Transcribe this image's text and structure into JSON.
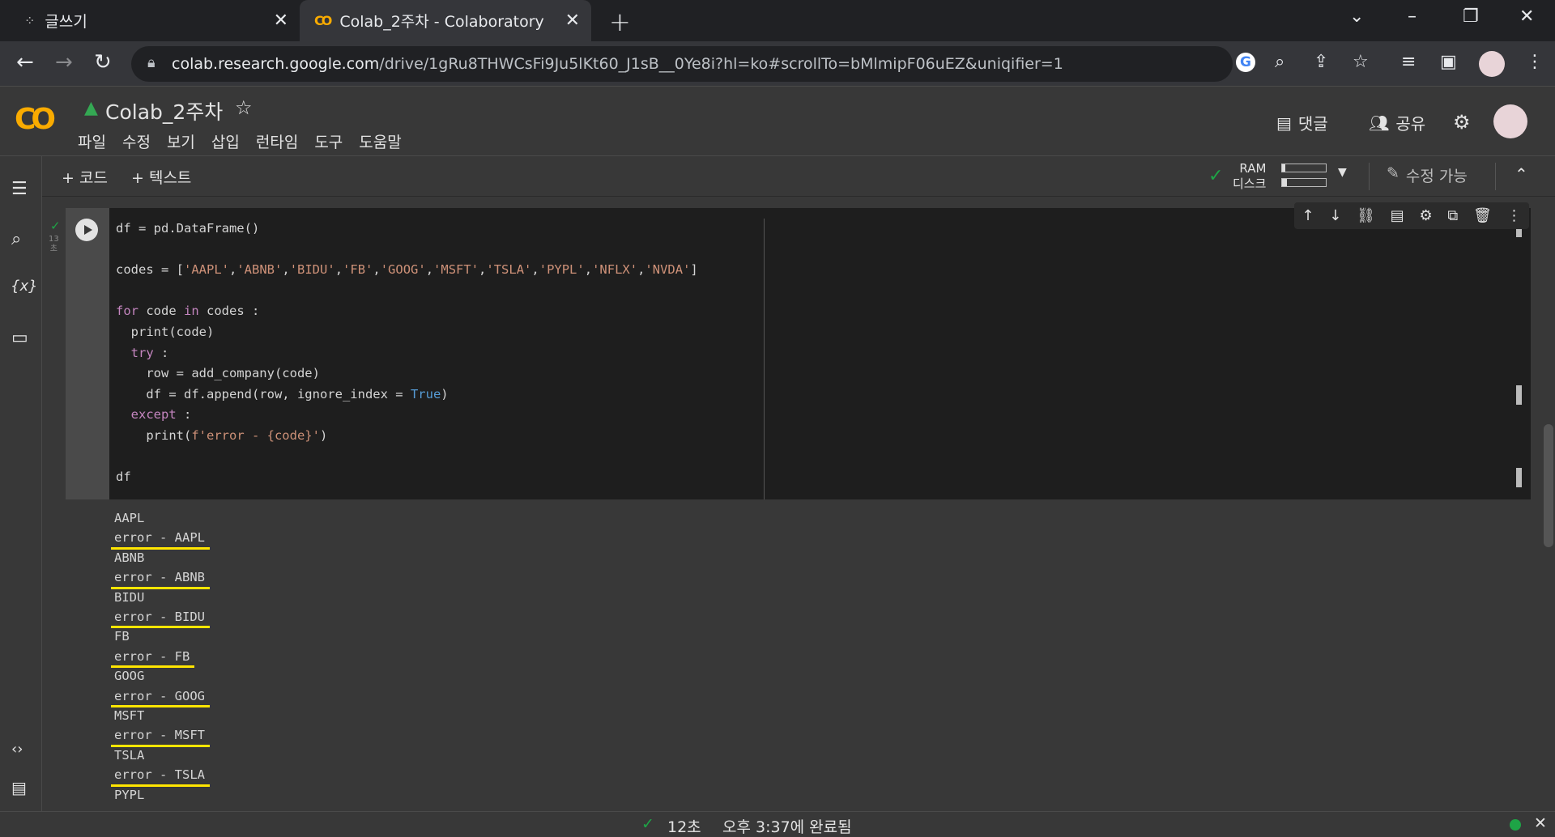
{
  "browser": {
    "tabs": [
      {
        "title": "글쓰기",
        "close": "✕"
      },
      {
        "title": "Colab_2주차 - Colaboratory",
        "close": "✕"
      }
    ],
    "new_tab": "+",
    "url_host": "colab.research.google.com",
    "url_path": "/drive/1gRu8THWCsFi9Ju5lKt60_J1sB__0Ye8i?hl=ko#scrollTo=bMlmipF06uEZ&uniqifier=1"
  },
  "colab": {
    "notebook_title": "Colab_2주차",
    "menu": [
      "파일",
      "수정",
      "보기",
      "삽입",
      "런타임",
      "도구",
      "도움말"
    ],
    "comment_label": "댓글",
    "share_label": "공유",
    "add_code_label": "+ 코드",
    "add_text_label": "+ 텍스트",
    "ram_label": "RAM",
    "disk_label": "디스크",
    "edit_mode_label": "수정 가능",
    "exec_count": "13",
    "exec_unit": "초"
  },
  "cell": {
    "lines": [
      "df = pd.DataFrame()",
      "",
      "codes = ['AAPL','ABNB','BIDU','FB','GOOG','MSFT','TSLA','PYPL','NFLX','NVDA']",
      "",
      "for code in codes :",
      "  print(code)",
      "  try :",
      "    row = add_company(code)",
      "    df = df.append(row, ignore_index = True)",
      "  except :",
      "    print(f'error - {code}')",
      "",
      "df"
    ],
    "output": [
      {
        "text": "AAPL",
        "highlight": false
      },
      {
        "text": "error - AAPL",
        "highlight": true
      },
      {
        "text": "ABNB",
        "highlight": false
      },
      {
        "text": "error - ABNB",
        "highlight": true
      },
      {
        "text": "BIDU",
        "highlight": false
      },
      {
        "text": "error - BIDU",
        "highlight": true
      },
      {
        "text": "FB",
        "highlight": false
      },
      {
        "text": "error - FB",
        "highlight": true
      },
      {
        "text": "GOOG",
        "highlight": false
      },
      {
        "text": "error - GOOG",
        "highlight": true
      },
      {
        "text": "MSFT",
        "highlight": false
      },
      {
        "text": "error - MSFT",
        "highlight": true
      },
      {
        "text": "TSLA",
        "highlight": false
      },
      {
        "text": "error - TSLA",
        "highlight": true
      },
      {
        "text": "PYPL",
        "highlight": false
      }
    ]
  },
  "status": {
    "duration": "12초",
    "completed": "오후 3:37에 완료됨",
    "connected_color": "#1ea446"
  },
  "colors": {
    "logo": "#f9ab00",
    "highlight": "#ffe500",
    "check": "#1ea446"
  }
}
